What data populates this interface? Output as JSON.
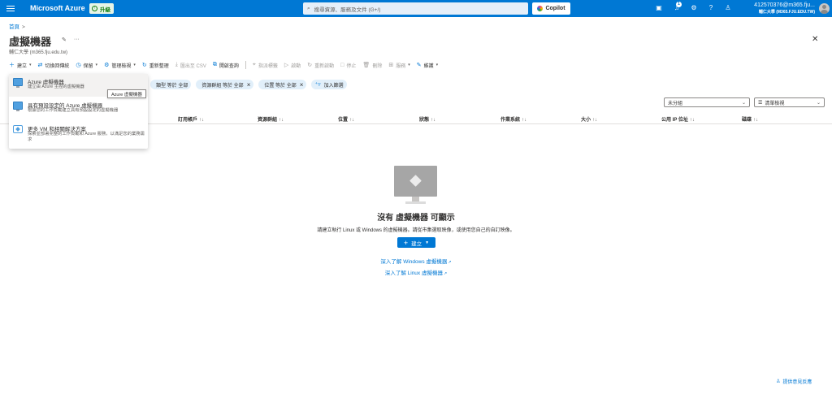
{
  "topbar": {
    "brand": "Microsoft Azure",
    "upgrade_label": "升級",
    "search_placeholder": "搜尋資源、服務及文件 (G+/)",
    "copilot_label": "Copilot",
    "notification_count": "1",
    "account_email": "412570376@m365.fju...",
    "account_org": "輔仁大學 (M365.FJU.EDU.TW)"
  },
  "breadcrumb": {
    "home": "首頁",
    "separator": ">"
  },
  "page": {
    "title": "虛擬機器",
    "subtitle": "輔仁大學 (m365.fju.edu.tw)"
  },
  "toolbar": {
    "create": "建立",
    "switch_classic": "切換回傳統",
    "reservations": "保留",
    "manage_view": "管理檢視",
    "refresh": "重新整理",
    "export_csv": "匯出至 CSV",
    "open_query": "開啟查詢",
    "assign_tags": "指派標籤",
    "start": "啟動",
    "restart": "重新啟動",
    "stop": "停止",
    "delete": "刪除",
    "services": "服務",
    "maintenance": "維護"
  },
  "filters": [
    {
      "label": "類型 等於 全部"
    },
    {
      "label": "資源群組 等於 全部"
    },
    {
      "label": "位置 等於 全部"
    }
  ],
  "add_filter": "加入篩選",
  "grouping": {
    "selected": "未分組"
  },
  "view_mode": {
    "selected": "清單檢視"
  },
  "columns": [
    "訂用帳戶",
    "資源群組",
    "位置",
    "狀態",
    "作業系統",
    "大小",
    "公用 IP 位址",
    "磁碟"
  ],
  "dropdown": [
    {
      "title": "Azure 虛擬機器",
      "desc": "建立由 Azure 主控的虛擬機器"
    },
    {
      "title": "具有預設設定的 Azure 虛擬機器",
      "desc": "根據您的工作負載建立具有預設設定的虛擬機器"
    },
    {
      "title": "更多 VM 和相關解決方案",
      "desc": "探索並部署完整的工作負載和 Azure 服務，以滿足您的業務需求"
    }
  ],
  "tooltip": "Azure 虛擬機器",
  "empty": {
    "title": "沒有 虛擬機器 可顯示",
    "description": "請建立執行 Linux 或 Windows 的虛擬機器。請從市集選取映像，或使用您自己的自訂映像。",
    "create_label": "建立",
    "learn_windows": "深入了解 Windows 虛擬機器",
    "learn_linux": "深入了解 Linux 虛擬機器"
  },
  "feedback": "提供意見反應",
  "colors": {
    "accent": "#0078d4",
    "pill_bg": "#e1effa"
  }
}
